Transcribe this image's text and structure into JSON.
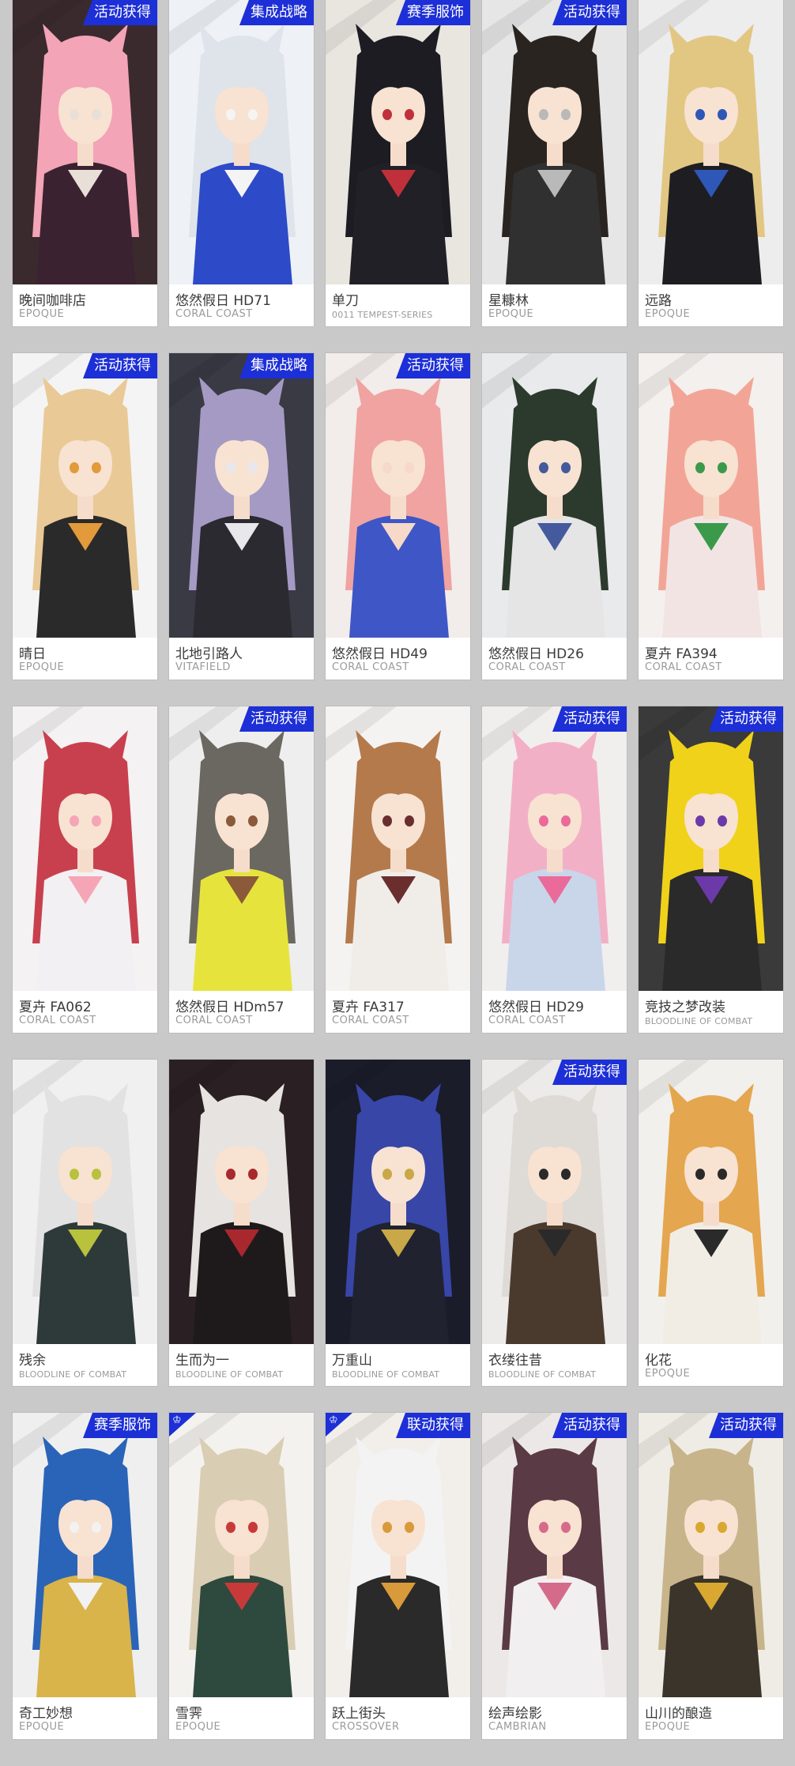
{
  "colors": {
    "background": "#c9c9c9",
    "badge": "#1d2fd6",
    "card": "#ffffff",
    "name_text": "#3a3a3a",
    "brand_text": "#9a9a9a"
  },
  "cards": [
    {
      "name": "晚间咖啡店",
      "brand": "EPOQUE",
      "badge": "活动获得",
      "art": {
        "bg": "#3a2a2e",
        "hair": "#f3a4b6",
        "outfit": "#3b2230",
        "accent": "#e8e0d8"
      }
    },
    {
      "name": "悠然假日 HD71",
      "brand": "CORAL COAST",
      "badge": "集成战略",
      "art": {
        "bg": "#eef1f6",
        "hair": "#dfe3ea",
        "outfit": "#2d4ac8",
        "accent": "#f4f4f4"
      }
    },
    {
      "name": "单刀",
      "brand": "0011 TEMPEST-SERIES",
      "badge": "赛季服饰",
      "art": {
        "bg": "#e9e5df",
        "hair": "#1c1c22",
        "outfit": "#202026",
        "accent": "#c0303a"
      }
    },
    {
      "name": "星糠林",
      "brand": "EPOQUE",
      "badge": "活动获得",
      "art": {
        "bg": "#e6e6e6",
        "hair": "#2a2420",
        "outfit": "#303030",
        "accent": "#b9b9b9"
      }
    },
    {
      "name": "远路",
      "brand": "EPOQUE",
      "badge": "",
      "art": {
        "bg": "#ededed",
        "hair": "#e2c783",
        "outfit": "#1e1e22",
        "accent": "#2f57b8"
      }
    },
    {
      "name": "晴日",
      "brand": "EPOQUE",
      "badge": "活动获得",
      "art": {
        "bg": "#f4f4f4",
        "hair": "#e9c995",
        "outfit": "#2a2a2a",
        "accent": "#e29a3a"
      }
    },
    {
      "name": "北地引路人",
      "brand": "VITAFIELD",
      "badge": "集成战略",
      "art": {
        "bg": "#3a3a44",
        "hair": "#a59ac4",
        "outfit": "#2a2a30",
        "accent": "#e8e8ec"
      }
    },
    {
      "name": "悠然假日 HD49",
      "brand": "CORAL COAST",
      "badge": "活动获得",
      "art": {
        "bg": "#f2ecea",
        "hair": "#f0a3a0",
        "outfit": "#3f56c6",
        "accent": "#f6d9c8"
      }
    },
    {
      "name": "悠然假日 HD26",
      "brand": "CORAL COAST",
      "badge": "",
      "art": {
        "bg": "#e9eaec",
        "hair": "#2c3a2e",
        "outfit": "#e5e5e5",
        "accent": "#445a9c"
      }
    },
    {
      "name": "夏卉 FA394",
      "brand": "CORAL COAST",
      "badge": "",
      "art": {
        "bg": "#f4f0ee",
        "hair": "#f2a596",
        "outfit": "#f3e4e4",
        "accent": "#3b9a4a"
      }
    },
    {
      "name": "夏卉 FA062",
      "brand": "CORAL COAST",
      "badge": "",
      "art": {
        "bg": "#f4f2f2",
        "hair": "#c8404e",
        "outfit": "#f2f0f2",
        "accent": "#f5a5b5"
      }
    },
    {
      "name": "悠然假日 HDm57",
      "brand": "CORAL COAST",
      "badge": "活动获得",
      "art": {
        "bg": "#eeeeee",
        "hair": "#6a6860",
        "outfit": "#e6e43c",
        "accent": "#8a5a3a"
      }
    },
    {
      "name": "夏卉 FA317",
      "brand": "CORAL COAST",
      "badge": "",
      "art": {
        "bg": "#f4f3f2",
        "hair": "#b47a4c",
        "outfit": "#f0ede8",
        "accent": "#6a2e2e"
      }
    },
    {
      "name": "悠然假日 HD29",
      "brand": "CORAL COAST",
      "badge": "活动获得",
      "art": {
        "bg": "#f1eeee",
        "hair": "#f2b0c6",
        "outfit": "#c9d6ea",
        "accent": "#ea6b9a"
      }
    },
    {
      "name": "竞技之梦改装",
      "brand": "BLOODLINE OF COMBAT",
      "badge": "活动获得",
      "art": {
        "bg": "#3a3a3a",
        "hair": "#f0d21a",
        "outfit": "#2a2a2a",
        "accent": "#6b3aa8"
      }
    },
    {
      "name": "残余",
      "brand": "BLOODLINE OF COMBAT",
      "badge": "",
      "art": {
        "bg": "#f0f0f0",
        "hair": "#e2e2e2",
        "outfit": "#2e3a3a",
        "accent": "#b8c23c"
      }
    },
    {
      "name": "生而为一",
      "brand": "BLOODLINE OF COMBAT",
      "badge": "",
      "art": {
        "bg": "#2a2024",
        "hair": "#e7e3e0",
        "outfit": "#1e1a1c",
        "accent": "#a8282e"
      }
    },
    {
      "name": "万重山",
      "brand": "BLOODLINE OF COMBAT",
      "badge": "",
      "art": {
        "bg": "#1a1c2a",
        "hair": "#3846a8",
        "outfit": "#202230",
        "accent": "#c8a848"
      }
    },
    {
      "name": "衣缕往昔",
      "brand": "BLOODLINE OF COMBAT",
      "badge": "活动获得",
      "art": {
        "bg": "#ecebea",
        "hair": "#dedad6",
        "outfit": "#4a3a2e",
        "accent": "#2a2a2a"
      }
    },
    {
      "name": "化花",
      "brand": "EPOQUE",
      "badge": "",
      "art": {
        "bg": "#f2f0ec",
        "hair": "#e4a64e",
        "outfit": "#f2ede4",
        "accent": "#2a2a2a"
      }
    },
    {
      "name": "奇工妙想",
      "brand": "EPOQUE",
      "badge": "赛季服饰",
      "art": {
        "bg": "#efefef",
        "hair": "#2a64b8",
        "outfit": "#d8b44a",
        "accent": "#f2f2f2"
      }
    },
    {
      "name": "雪霁",
      "brand": "EPOQUE",
      "badge": "",
      "corner": true,
      "art": {
        "bg": "#f4f2ee",
        "hair": "#d9cdb4",
        "outfit": "#2e4a3e",
        "accent": "#c83a3a"
      }
    },
    {
      "name": "跃上街头",
      "brand": "CROSSOVER",
      "badge": "联动获得",
      "corner": true,
      "art": {
        "bg": "#f2eeea",
        "hair": "#f3f3f3",
        "outfit": "#2a2a2a",
        "accent": "#d89a3a"
      }
    },
    {
      "name": "绘声绘影",
      "brand": "CAMBRIAN",
      "badge": "活动获得",
      "art": {
        "bg": "#ece8e8",
        "hair": "#5a3a44",
        "outfit": "#f2eff0",
        "accent": "#d56b8a"
      }
    },
    {
      "name": "山川的酿造",
      "brand": "EPOQUE",
      "badge": "活动获得",
      "art": {
        "bg": "#efece6",
        "hair": "#c8b48a",
        "outfit": "#3a342a",
        "accent": "#d9a830"
      }
    }
  ]
}
